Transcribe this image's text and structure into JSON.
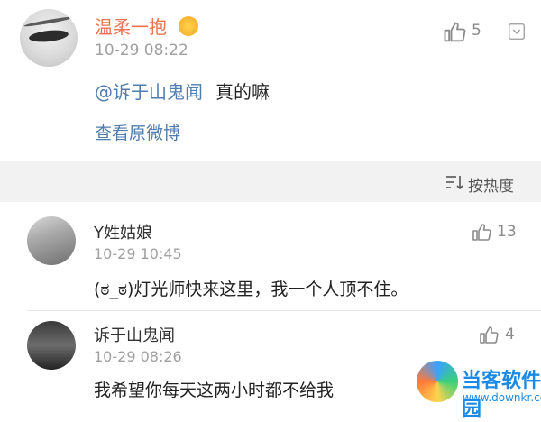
{
  "top_comment": {
    "username": "温柔一抱",
    "time": "10-29 08:22",
    "likes": "5",
    "mention": "@诉于山鬼闻",
    "text": "真的嘛",
    "view_original": "查看原微博"
  },
  "sort": {
    "label": "按热度"
  },
  "comments": [
    {
      "username": "Y姓姑娘",
      "time": "10-29 10:45",
      "likes": "13",
      "text": "(ಠ_ಠ)灯光师快来这里，我一个人顶不住。"
    },
    {
      "username": "诉于山鬼闻",
      "time": "10-29 08:26",
      "likes": "4",
      "text": "我希望你每天这两小时都不给我"
    }
  ],
  "watermark": {
    "title": "当客软件园",
    "url": "www.downkr.com"
  }
}
